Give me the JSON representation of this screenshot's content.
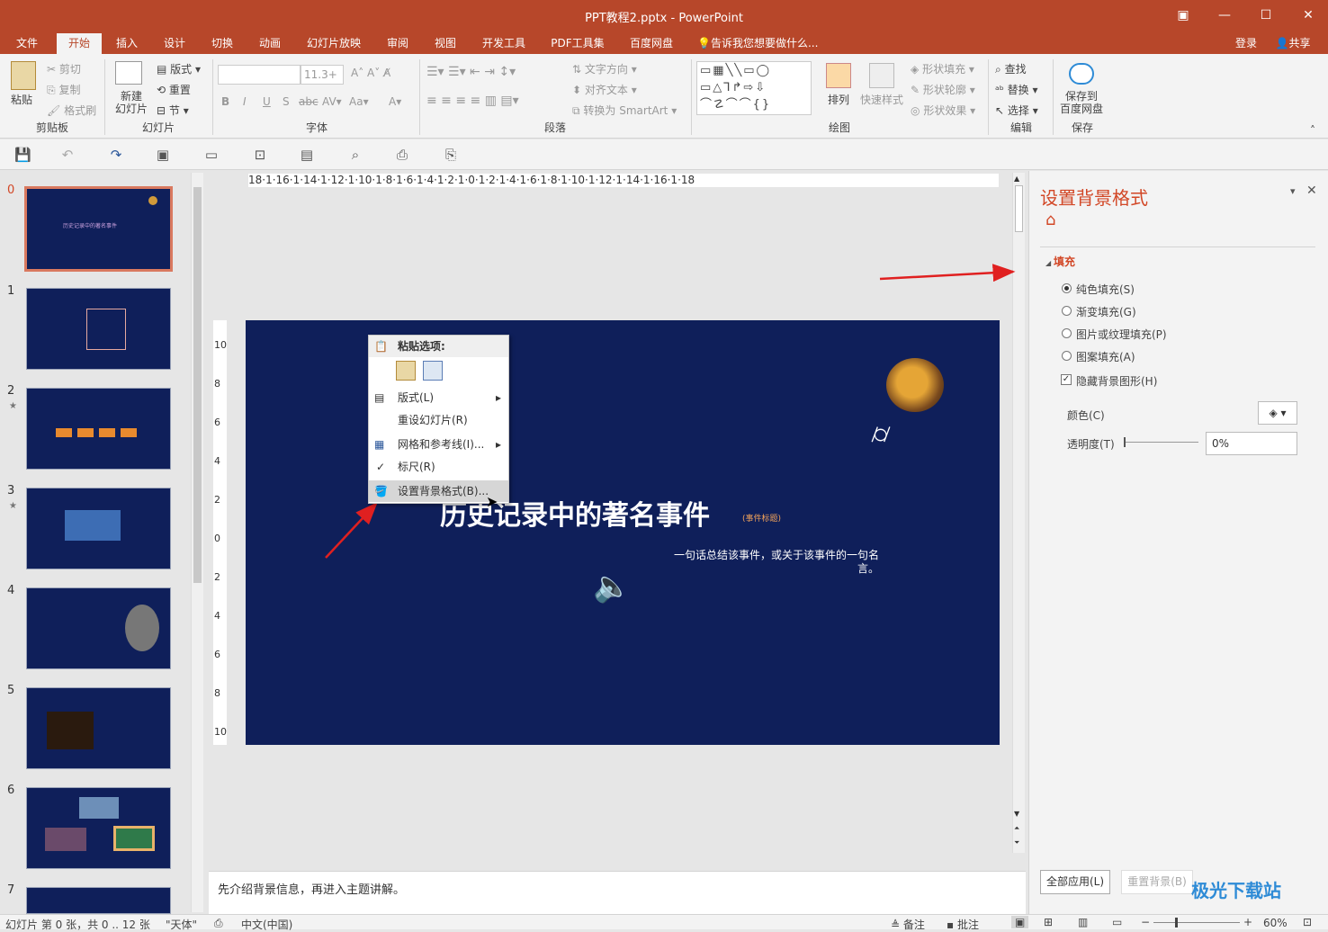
{
  "window": {
    "title": "PPT教程2.pptx - PowerPoint"
  },
  "tabs": [
    "文件",
    "开始",
    "插入",
    "设计",
    "切换",
    "动画",
    "幻灯片放映",
    "审阅",
    "视图",
    "开发工具",
    "PDF工具集",
    "百度网盘"
  ],
  "active_tab": "开始",
  "tell_me": "告诉我您想要做什么...",
  "account": {
    "login": "登录",
    "share": "共享"
  },
  "ribbon": {
    "clipboard": {
      "label": "剪贴板",
      "paste": "粘贴",
      "cut": "剪切",
      "copy": "复制",
      "format_painter": "格式刷"
    },
    "slides": {
      "label": "幻灯片",
      "new_slide": "新建\n幻灯片",
      "layout": "版式",
      "reset": "重置",
      "section": "节"
    },
    "font": {
      "label": "字体",
      "size": "11.3+"
    },
    "paragraph": {
      "label": "段落",
      "text_direction": "文字方向",
      "align_text": "对齐文本",
      "smartart": "转换为 SmartArt"
    },
    "drawing": {
      "label": "绘图",
      "arrange": "排列",
      "quick_styles": "快速样式",
      "shape_fill": "形状填充",
      "shape_outline": "形状轮廓",
      "shape_effects": "形状效果"
    },
    "editing": {
      "label": "编辑",
      "find": "查找",
      "replace": "替换",
      "select": "选择"
    },
    "save": {
      "label": "保存",
      "save_baidu": "保存到\n百度网盘"
    }
  },
  "thumbnails": [
    {
      "num": "0",
      "star": false,
      "text": "历史记录中的著名事件"
    },
    {
      "num": "1",
      "star": false,
      "text": ""
    },
    {
      "num": "2",
      "star": true,
      "text": ""
    },
    {
      "num": "3",
      "star": true,
      "text": ""
    },
    {
      "num": "4",
      "star": false,
      "text": ""
    },
    {
      "num": "5",
      "star": false,
      "text": ""
    },
    {
      "num": "6",
      "star": false,
      "text": ""
    },
    {
      "num": "7",
      "star": false,
      "text": ""
    }
  ],
  "ruler_h": "18·1·16·1·14·1·12·1·10·1·8·1·6·1·4·1·2·1·0·1·2·1·4·1·6·1·8·1·10·1·12·1·14·1·16·1·18",
  "ruler_v": [
    "10",
    "8",
    "6",
    "4",
    "2",
    "0",
    "2",
    "4",
    "6",
    "8",
    "10"
  ],
  "slide": {
    "title": "历史记录中的著名事件",
    "tag": "(事件标题)",
    "subtitle_line1": "一句话总结该事件，或关于该事件的一句名",
    "subtitle_line2": "言。"
  },
  "context_menu": {
    "paste_options": "粘贴选项:",
    "layout": "版式(L)",
    "reset_slide": "重设幻灯片(R)",
    "grid_guides": "网格和参考线(I)...",
    "ruler": "标尺(R)",
    "format_bg": "设置背景格式(B)..."
  },
  "notes": "先介绍背景信息，再进入主题讲解。",
  "format_pane": {
    "title": "设置背景格式",
    "section": "填充",
    "options": [
      "纯色填充(S)",
      "渐变填充(G)",
      "图片或纹理填充(P)",
      "图案填充(A)"
    ],
    "selected_option": "纯色填充(S)",
    "hide_bg": "隐藏背景图形(H)",
    "hide_bg_checked": true,
    "color_label": "颜色(C)",
    "transparency_label": "透明度(T)",
    "transparency_value": "0%",
    "apply_all": "全部应用(L)",
    "reset_bg": "重置背景(B)"
  },
  "statusbar": {
    "slide_info": "幻灯片 第 0 张，共 0 .. 12 张",
    "theme": "\"天体\"",
    "language": "中文(中国)",
    "notes": "备注",
    "comments": "批注",
    "zoom": "60%"
  },
  "watermark": "极光下载站",
  "colors": {
    "accent": "#b7472a",
    "slide_bg": "#0f1f5a",
    "pane_title": "#d24726"
  }
}
